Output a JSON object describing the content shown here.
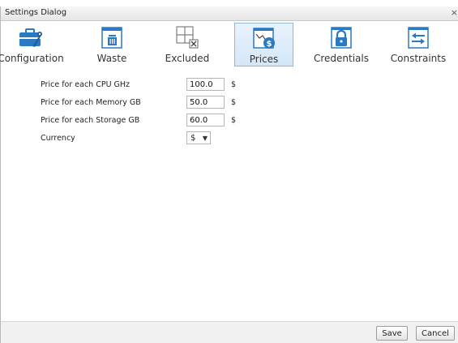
{
  "dialog": {
    "title": "Settings Dialog",
    "close": "×"
  },
  "toolbar": {
    "items": [
      {
        "label": "Configuration",
        "icon": "configuration-icon"
      },
      {
        "label": "Waste",
        "icon": "waste-bin-icon"
      },
      {
        "label": "Excluded",
        "icon": "excluded-grid-icon"
      },
      {
        "label": "Prices",
        "icon": "prices-dollar-icon",
        "active": true
      },
      {
        "label": "Credentials",
        "icon": "credentials-lock-icon"
      },
      {
        "label": "Constraints",
        "icon": "constraints-arrows-icon"
      }
    ]
  },
  "form": {
    "cpu": {
      "label": "Price for each CPU GHz",
      "value": "100.0",
      "unit": "$"
    },
    "memory": {
      "label": "Price for each Memory GB",
      "value": "50.0",
      "unit": "$"
    },
    "storage": {
      "label": "Price for each Storage GB",
      "value": "60.0",
      "unit": "$"
    },
    "currency": {
      "label": "Currency",
      "value": "$"
    }
  },
  "footer": {
    "save_label": "Save",
    "cancel_label": "Cancel"
  },
  "colors": {
    "icon_blue": "#2a79c3",
    "active_border": "#8fb7de"
  }
}
